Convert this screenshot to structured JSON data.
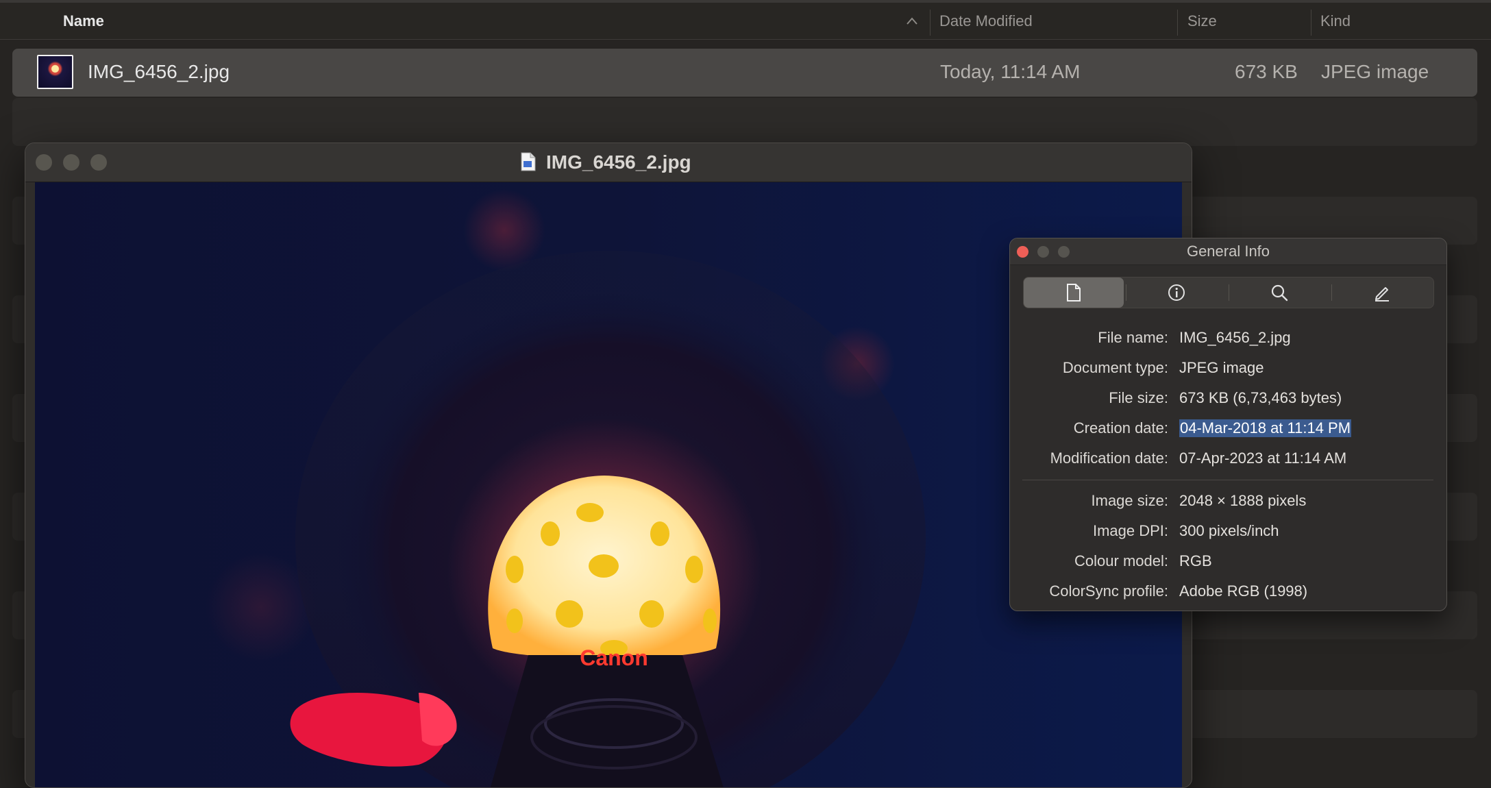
{
  "finder": {
    "columns": {
      "name": "Name",
      "date_modified": "Date Modified",
      "size": "Size",
      "kind": "Kind"
    },
    "rows": [
      {
        "name": "IMG_6456_2.jpg",
        "date_modified": "Today, 11:14 AM",
        "size": "673 KB",
        "kind": "JPEG image"
      }
    ]
  },
  "preview_window": {
    "title": "IMG_6456_2.jpg",
    "icons": [
      "close-icon",
      "minimize-icon",
      "zoom-icon",
      "document-icon"
    ],
    "photo_text": "Canon"
  },
  "info_panel": {
    "title": "General Info",
    "tabs": [
      "general-info-tab",
      "more-info-tab",
      "keywords-tab",
      "annotations-tab"
    ],
    "rows": [
      {
        "label": "File name:",
        "value": "IMG_6456_2.jpg"
      },
      {
        "label": "Document type:",
        "value": "JPEG image"
      },
      {
        "label": "File size:",
        "value": "673 KB (6,73,463 bytes)"
      },
      {
        "label": "Creation date:",
        "value": "04-Mar-2018 at 11:14 PM"
      },
      {
        "label": "Modification date:",
        "value": "07-Apr-2023 at 11:14 AM"
      },
      {
        "label": "Image size:",
        "value": "2048 × 1888 pixels"
      },
      {
        "label": "Image DPI:",
        "value": "300 pixels/inch"
      },
      {
        "label": "Colour model:",
        "value": "RGB"
      },
      {
        "label": "ColorSync profile:",
        "value": "Adobe RGB (1998)"
      }
    ]
  },
  "colors": {
    "selection": "#3b5b8f",
    "close_button": "#ee5f57",
    "selected_row": "#494745"
  }
}
